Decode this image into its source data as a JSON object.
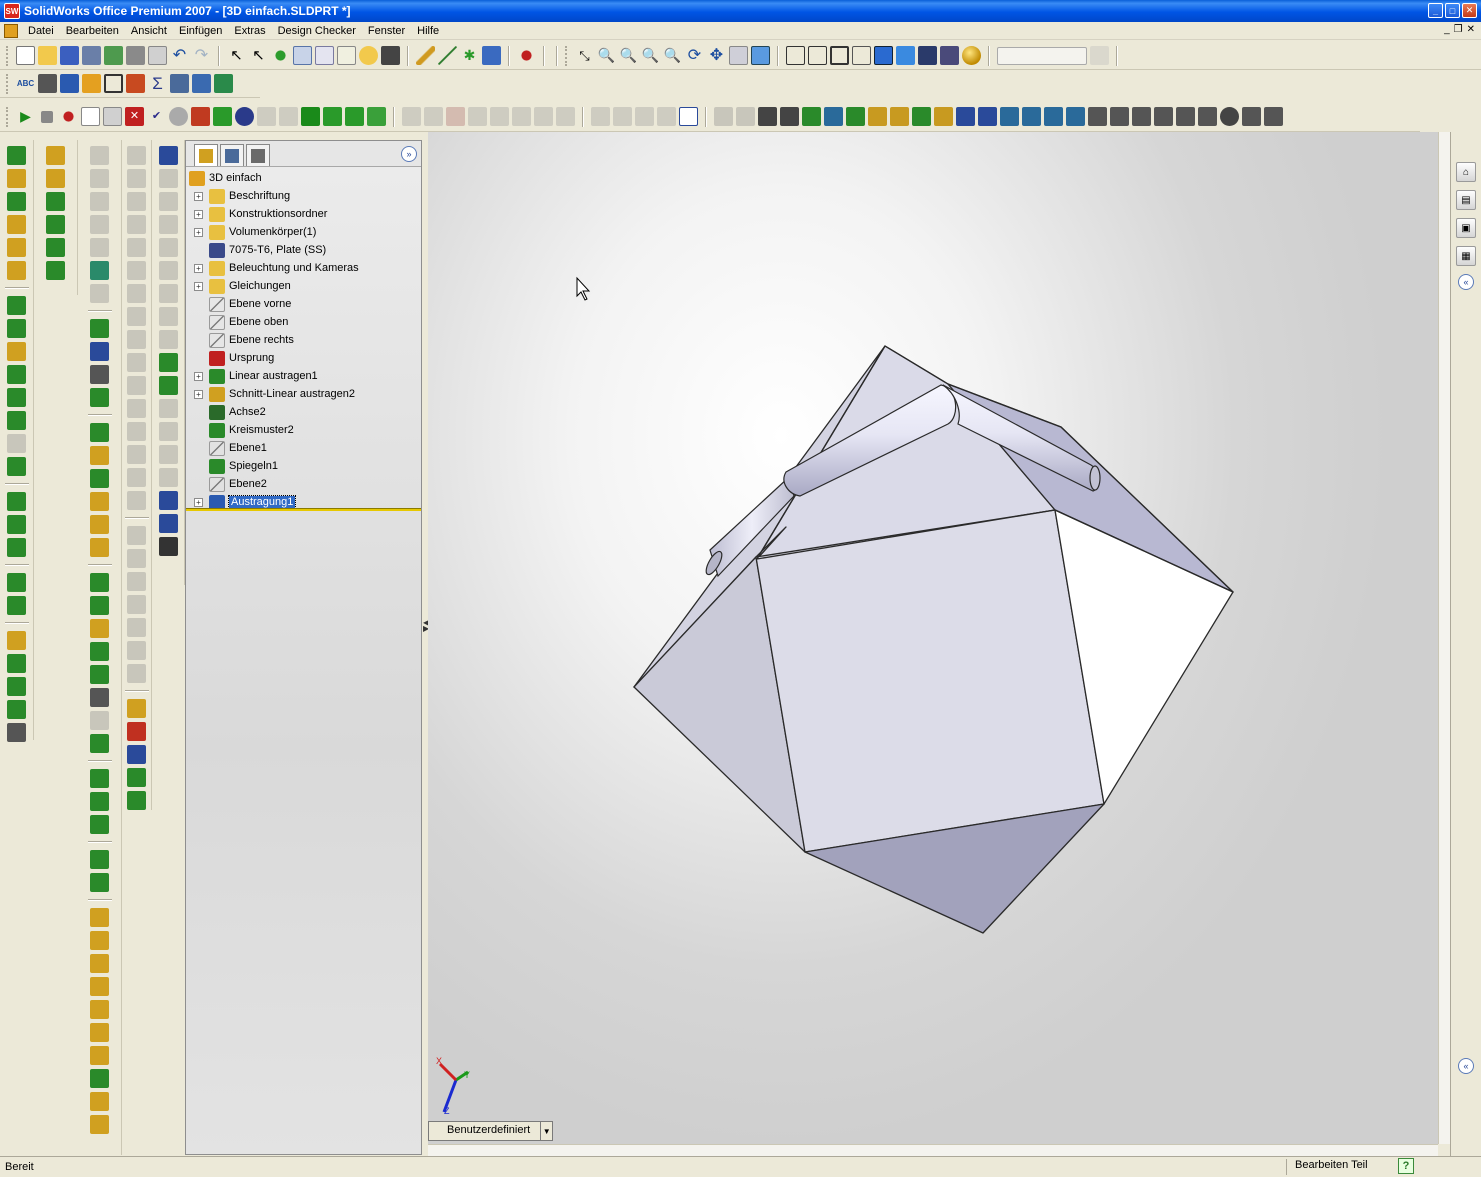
{
  "window": {
    "title": "SolidWorks Office Premium 2007 - [3D einfach.SLDPRT *]",
    "app_badge": "SW"
  },
  "menu": {
    "items": [
      "Datei",
      "Bearbeiten",
      "Ansicht",
      "Einfügen",
      "Extras",
      "Design Checker",
      "Fenster",
      "Hilfe"
    ]
  },
  "feature_tree": {
    "root": "3D einfach",
    "items": [
      {
        "label": "Beschriftung",
        "expandable": true,
        "icon": "annotation-icon"
      },
      {
        "label": "Konstruktionsordner",
        "expandable": true,
        "icon": "folder-icon"
      },
      {
        "label": "Volumenkörper(1)",
        "expandable": true,
        "icon": "solid-body-icon"
      },
      {
        "label": "7075-T6, Plate (SS)",
        "expandable": false,
        "icon": "material-icon"
      },
      {
        "label": "Beleuchtung und Kameras",
        "expandable": true,
        "icon": "lighting-icon"
      },
      {
        "label": "Gleichungen",
        "expandable": true,
        "icon": "equations-icon"
      },
      {
        "label": "Ebene vorne",
        "expandable": false,
        "icon": "plane-icon"
      },
      {
        "label": "Ebene oben",
        "expandable": false,
        "icon": "plane-icon"
      },
      {
        "label": "Ebene rechts",
        "expandable": false,
        "icon": "plane-icon"
      },
      {
        "label": "Ursprung",
        "expandable": false,
        "icon": "origin-icon"
      },
      {
        "label": "Linear austragen1",
        "expandable": true,
        "icon": "extrude-icon"
      },
      {
        "label": "Schnitt-Linear austragen2",
        "expandable": true,
        "icon": "cut-extrude-icon"
      },
      {
        "label": "Achse2",
        "expandable": false,
        "icon": "axis-icon"
      },
      {
        "label": "Kreismuster2",
        "expandable": false,
        "icon": "circular-pattern-icon"
      },
      {
        "label": "Ebene1",
        "expandable": false,
        "icon": "plane-icon"
      },
      {
        "label": "Spiegeln1",
        "expandable": false,
        "icon": "mirror-icon"
      },
      {
        "label": "Ebene2",
        "expandable": false,
        "icon": "plane-icon"
      },
      {
        "label": "Austragung1",
        "expandable": true,
        "icon": "sweep-icon",
        "selected": true
      }
    ]
  },
  "viewport": {
    "view_orientation": "Benutzerdefiniert",
    "triad": {
      "x": "X",
      "y": "Y",
      "z": "Z"
    }
  },
  "status": {
    "left": "Bereit",
    "right": "Bearbeiten Teil",
    "help": "?"
  },
  "colors": {
    "titlebar": "#0055e5",
    "selection": "#316ac5",
    "rollback_bar": "#e6c800",
    "model_face": "#d8d8e8"
  }
}
